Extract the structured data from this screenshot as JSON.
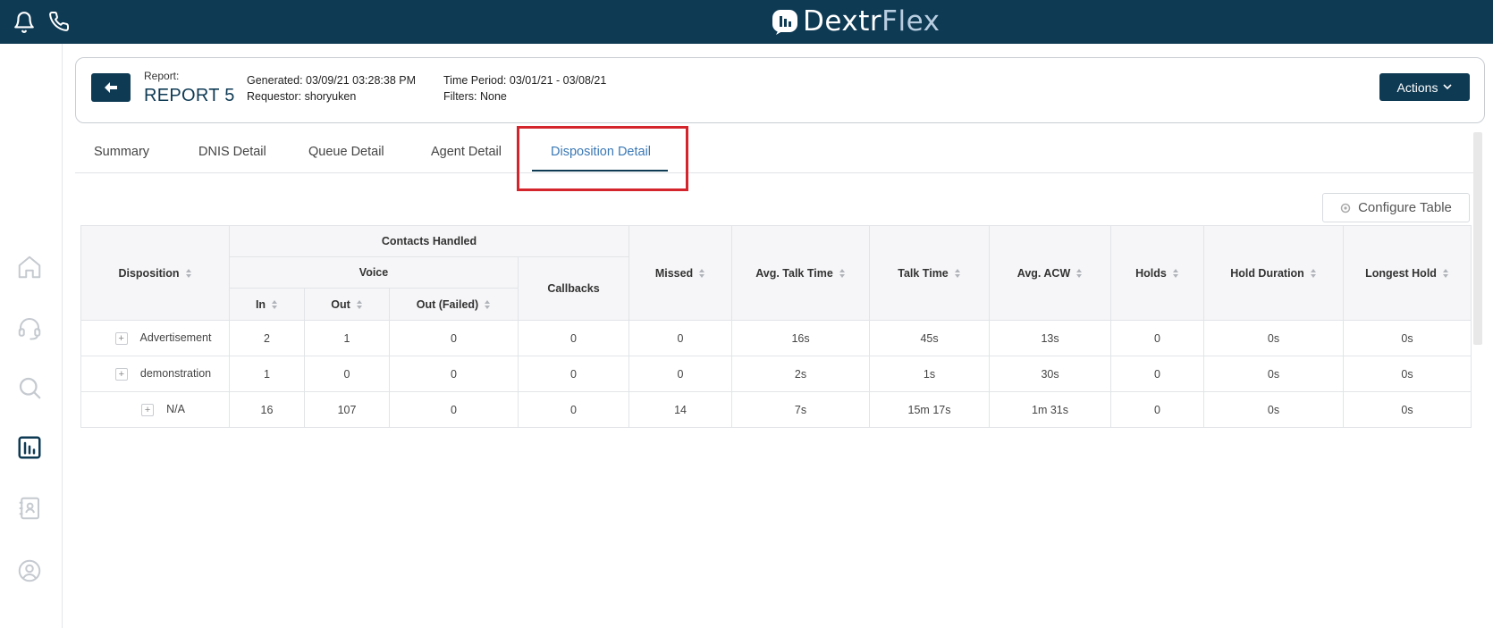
{
  "brand": {
    "name_part1": "Dextr",
    "name_part2": "Flex"
  },
  "topbar": {
    "icons": [
      "bell-icon",
      "phone-icon"
    ]
  },
  "sidebar": {
    "items": [
      "home-icon",
      "headset-icon",
      "search-icon",
      "reports-icon",
      "contacts-icon",
      "user-circle-icon"
    ]
  },
  "report": {
    "label": "Report:",
    "name": "REPORT 5",
    "generated": "Generated: 03/09/21 03:28:38 PM",
    "requestor": "Requestor: shoryuken",
    "time_period": "Time Period: 03/01/21 - 03/08/21",
    "filters": "Filters: None",
    "actions_label": "Actions"
  },
  "tabs": [
    "Summary",
    "DNIS Detail",
    "Queue Detail",
    "Agent Detail",
    "Disposition Detail"
  ],
  "active_tab": "Disposition Detail",
  "configure_label": "Configure Table",
  "table": {
    "headers": {
      "disposition": "Disposition",
      "contacts_handled": "Contacts Handled",
      "voice": "Voice",
      "in": "In",
      "out": "Out",
      "out_failed": "Out (Failed)",
      "callbacks": "Callbacks",
      "missed": "Missed",
      "avg_talk": "Avg. Talk Time",
      "talk": "Talk Time",
      "avg_acw": "Avg. ACW",
      "holds": "Holds",
      "hold_duration": "Hold Duration",
      "longest_hold": "Longest Hold"
    },
    "rows": [
      [
        "Advertisement",
        "2",
        "1",
        "0",
        "0",
        "0",
        "16s",
        "45s",
        "13s",
        "0",
        "0s",
        "0s"
      ],
      [
        "demonstration",
        "1",
        "0",
        "0",
        "0",
        "0",
        "2s",
        "1s",
        "30s",
        "0",
        "0s",
        "0s"
      ],
      [
        "N/A",
        "16",
        "107",
        "0",
        "0",
        "14",
        "7s",
        "15m 17s",
        "1m 31s",
        "0",
        "0s",
        "0s"
      ]
    ]
  },
  "colors": {
    "brand_navy": "#0e3a54",
    "active_tab": "#3a78b5",
    "highlight": "#d4242c"
  }
}
